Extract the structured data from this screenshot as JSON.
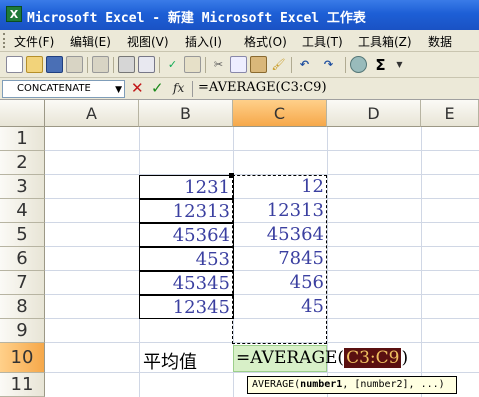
{
  "window": {
    "title": "Microsoft Excel - 新建 Microsoft Excel 工作表",
    "icon": "excel-icon"
  },
  "menu": [
    "文件(F)",
    "编辑(E)",
    "视图(V)",
    "插入(I)",
    "格式(O)",
    "工具(T)",
    "工具箱(Z)",
    "数据"
  ],
  "toolbar": {
    "icons": [
      "new-icon",
      "open-icon",
      "save-icon",
      "permission-icon",
      "email-icon",
      "print-icon",
      "print-preview-icon",
      "spelling-icon",
      "research-icon",
      "cut-icon",
      "copy-icon",
      "paste-icon",
      "format-painter-icon",
      "undo-icon",
      "redo-icon",
      "hyperlink-icon",
      "autosum-icon"
    ],
    "autosum_glyph": "Σ"
  },
  "formula_bar": {
    "name_box": "CONCATENATE",
    "cancel_glyph": "✕",
    "enter_glyph": "✓",
    "fx_label": "fx",
    "formula": "=AVERAGE(C3:C9)"
  },
  "grid": {
    "columns": [
      "A",
      "B",
      "C",
      "D",
      "E"
    ],
    "rows": [
      "1",
      "2",
      "3",
      "4",
      "5",
      "6",
      "7",
      "8",
      "9",
      "10",
      "11"
    ],
    "column_b": [
      "1231",
      "12313",
      "45364",
      "453",
      "45345",
      "12345"
    ],
    "column_c": [
      "12",
      "12313",
      "45364",
      "7845",
      "456",
      "45"
    ],
    "label_b10": "平均值",
    "edit_prefix": "=AVERAGE(",
    "edit_ref": "C3:C9",
    "edit_suffix": ")",
    "tooltip": "AVERAGE(number1, [number2], ...)",
    "tooltip_fn": "AVERAGE(",
    "tooltip_arg1": "number1",
    "tooltip_rest": ", [number2], ...)"
  }
}
